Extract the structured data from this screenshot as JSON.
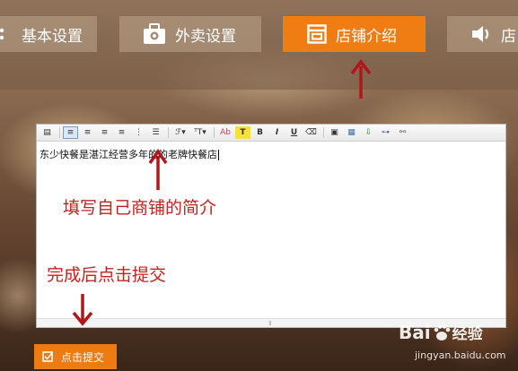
{
  "nav": {
    "tabs": [
      {
        "label": "基本设置",
        "icon": "settings-icon",
        "active": false
      },
      {
        "label": "外卖设置",
        "icon": "takeout-box-icon",
        "active": false
      },
      {
        "label": "店铺介绍",
        "icon": "store-layout-icon",
        "active": true
      },
      {
        "label": "店",
        "icon": "speaker-icon",
        "active": false
      }
    ]
  },
  "editor": {
    "content": "东少快餐是湛江经营多年的的老牌快餐店",
    "toolbar_labels": {
      "bold": "B",
      "italic": "I",
      "underline": "U",
      "font_color": "Ab",
      "highlight": "T"
    }
  },
  "annotations": {
    "fill_intro": "填写自己商铺的简介",
    "submit_hint": "完成后点击提交"
  },
  "submit": {
    "label": "点击提交"
  },
  "watermark": {
    "logo": "Bai",
    "suffix": "经验",
    "url": "jingyan.baidu.com"
  },
  "colors": {
    "accent": "#f07d14",
    "annotation": "#c8201c"
  }
}
